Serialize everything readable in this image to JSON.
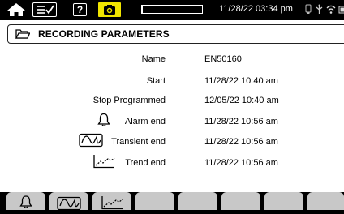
{
  "statusbar": {
    "datetime": "11/28/22 03:34 pm",
    "recording_progress": 0.02,
    "icons": [
      "home-icon",
      "menu-check-icon",
      "help-icon",
      "camera-icon",
      "usb-icon",
      "wifi-icon",
      "battery-icon"
    ],
    "camera_color": "#f2e600"
  },
  "panel": {
    "title": "RECORDING PARAMETERS",
    "title_icon": "folder-icon"
  },
  "params": [
    {
      "label": "Name",
      "value": "EN50160",
      "icon": null
    },
    {
      "label": "Start",
      "value": "11/28/22 10:40 am",
      "icon": null
    },
    {
      "label": "Stop Programmed",
      "value": "12/05/22 10:40 am",
      "icon": null
    },
    {
      "label": "Alarm end",
      "value": "11/28/22 10:56 am",
      "icon": "bell-icon"
    },
    {
      "label": "Transient end",
      "value": "11/28/22 10:56 am",
      "icon": "transient-icon"
    },
    {
      "label": "Trend end",
      "value": "11/28/22 10:56 am",
      "icon": "trend-icon"
    }
  ],
  "softkeys": [
    {
      "icon": "bell-icon"
    },
    {
      "icon": "transient-icon"
    },
    {
      "icon": "trend-icon"
    },
    {
      "icon": null
    },
    {
      "icon": null
    },
    {
      "icon": null
    },
    {
      "icon": null
    },
    {
      "icon": null
    }
  ]
}
